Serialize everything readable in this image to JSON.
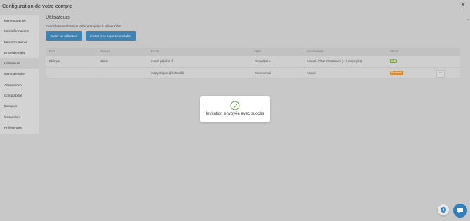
{
  "window": {
    "title": "Configuration de votre compte"
  },
  "sidebar": {
    "items": [
      {
        "label": "Mon entreprise"
      },
      {
        "label": "Mes informations"
      },
      {
        "label": "Mes documents"
      },
      {
        "label": "Envoi d'emails"
      },
      {
        "label": "Utilisateurs",
        "active": true
      },
      {
        "label": "Mon calendrier"
      },
      {
        "label": "Abonnement"
      },
      {
        "label": "Comptabilité"
      },
      {
        "label": "Banques"
      },
      {
        "label": "Connexion"
      },
      {
        "label": "Préférences"
      }
    ]
  },
  "main": {
    "title": "Utilisateurs",
    "subtitle": "Invitez les membres de votre entreprise à utiliser Obat",
    "buttons": {
      "invite_user": "Inviter un utilisateur",
      "invite_accountant": "Inviter mon expert comptable"
    }
  },
  "table": {
    "headers": {
      "nom": "Nom",
      "prenom": "Prénom",
      "email": "Email",
      "role": "Rôle",
      "abonnement": "Abonnement",
      "statut": "Statut"
    },
    "rows": [
      {
        "nom": "Philippe",
        "prenom": "Martin",
        "email": "martin.p@obat.fr",
        "role": "Propriétaire",
        "abonnement": "Annuel - Obat Croissance (+ 2 employés)",
        "statut": "Actif"
      },
      {
        "nom": "-",
        "prenom": "-",
        "email": "martyphilippe@hotmail.fr",
        "role": "Commercial",
        "abonnement": "Annuel",
        "statut": "En attente"
      }
    ]
  },
  "toast": {
    "message": "Invitation envoyée avec succès"
  },
  "icons": {
    "close": "close-icon",
    "success": "check-circle-icon",
    "more": "more-horizontal-icon",
    "help": "help-icon",
    "chat": "chat-icon"
  },
  "colors": {
    "primary": "#3f83b5",
    "status_active": "#7aa33f",
    "status_pending": "#d88d33",
    "success_icon": "#6a9b40",
    "overlay": "#c8c8c8",
    "chat_button": "#2f7fc1"
  }
}
